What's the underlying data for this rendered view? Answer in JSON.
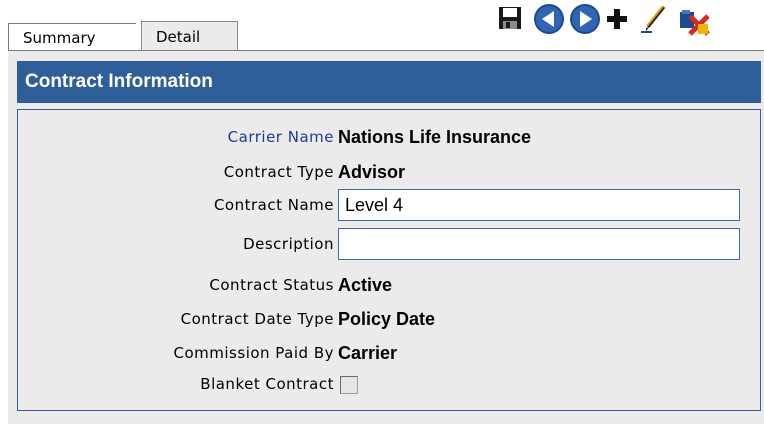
{
  "tabs": [
    {
      "label": "Summary"
    },
    {
      "label": "Detail"
    }
  ],
  "toolbar": {
    "icons": [
      "save-icon",
      "previous-icon",
      "next-icon",
      "add-icon",
      "edit-icon",
      "delete-icon"
    ]
  },
  "panel": {
    "title": "Contract Information"
  },
  "fields": {
    "carrier_name": {
      "label": "Carrier Name",
      "value": "Nations Life Insurance"
    },
    "contract_type": {
      "label": "Contract Type",
      "value": "Advisor"
    },
    "contract_name": {
      "label": "Contract Name",
      "value": "Level 4"
    },
    "description": {
      "label": "Description",
      "value": ""
    },
    "contract_status": {
      "label": "Contract Status",
      "value": "Active"
    },
    "contract_date_type": {
      "label": "Contract Date Type",
      "value": "Policy Date"
    },
    "commission_paid_by": {
      "label": "Commission Paid By",
      "value": "Carrier"
    },
    "blanket_contract": {
      "label": "Blanket Contract",
      "checked": false
    }
  },
  "colors": {
    "header": "#2f5f9a",
    "panel_bg": "#ecebea",
    "link": "#1a3a9c"
  }
}
